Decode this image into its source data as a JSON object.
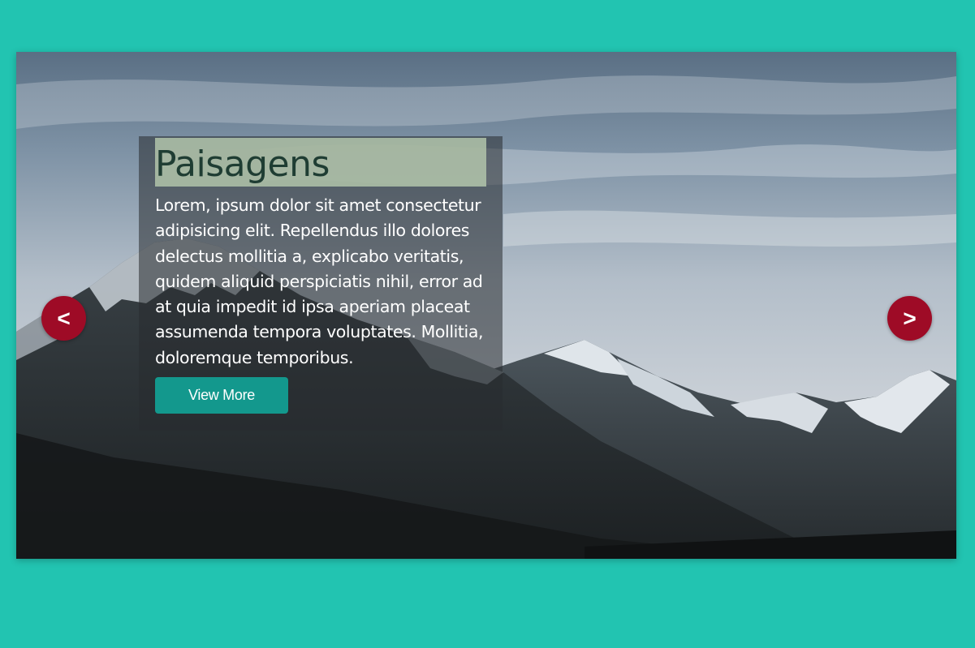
{
  "slide": {
    "title": "Paisagens",
    "description": "Lorem, ipsum dolor sit amet consectetur adipisicing elit. Repellendus illo dolores delectus mollitia a, explicabo veritatis, quidem aliquid perspiciatis nihil, error ad at quia impedit id ipsa aperiam placeat assumenda tempora voluptates. Mollitia, doloremque temporibus.",
    "button_label": "View More",
    "image_icon": "mountain-landscape-image"
  },
  "navigation": {
    "prev_label": "<",
    "next_label": ">"
  },
  "colors": {
    "page_background": "#22c4b1",
    "nav_button": "#9e0b26",
    "view_more_button": "#13988d",
    "title_highlight": "#b2c4aa",
    "title_text": "#1f3d33"
  }
}
